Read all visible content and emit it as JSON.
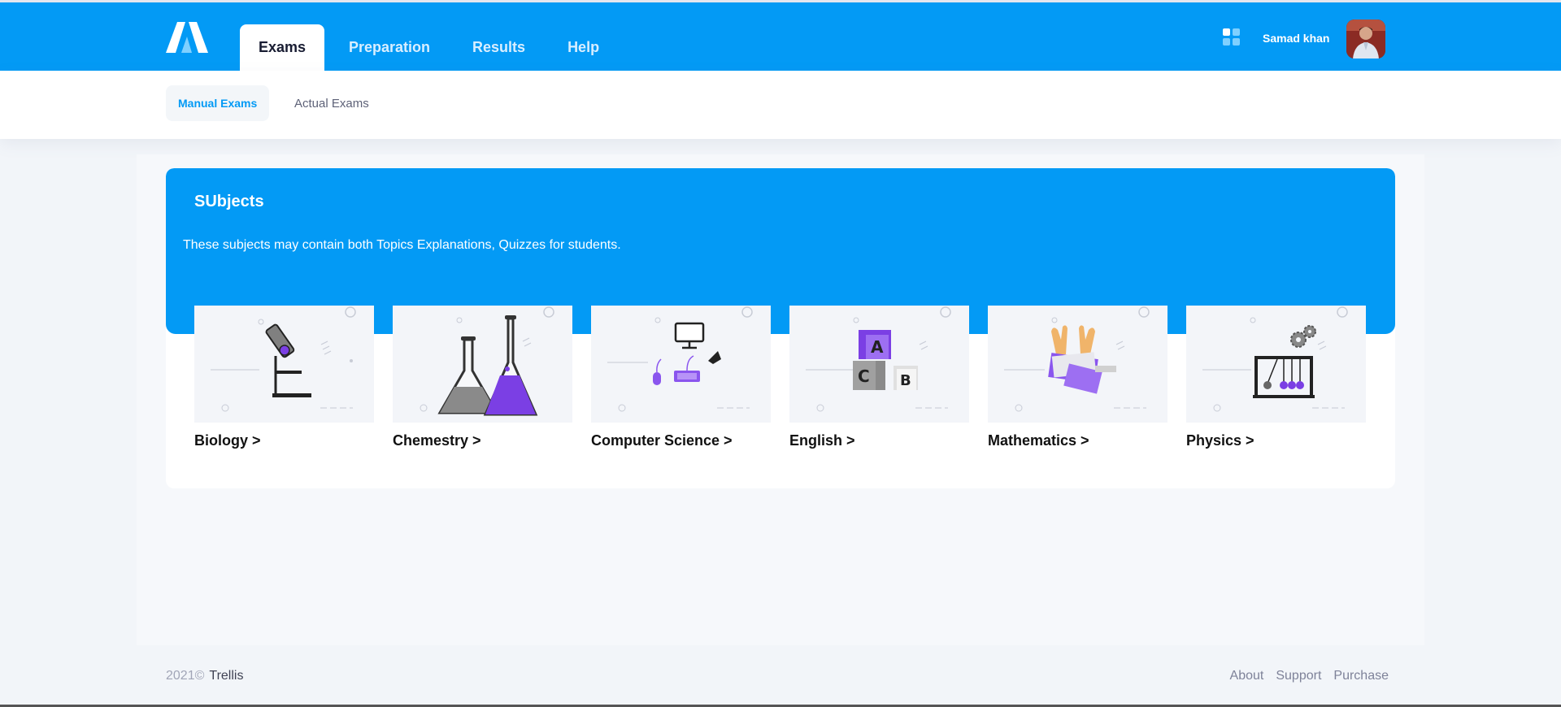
{
  "header": {
    "nav_tabs": [
      {
        "label": "Exams",
        "active": true
      },
      {
        "label": "Preparation",
        "active": false
      },
      {
        "label": "Results",
        "active": false
      },
      {
        "label": "Help",
        "active": false
      }
    ],
    "user_name": "Samad khan",
    "icons": {
      "logo": "brand-logo-icon",
      "apps": "apps-grid-icon",
      "avatar": "user-avatar"
    }
  },
  "subnav": {
    "tabs": [
      {
        "label": "Manual Exams",
        "active": true
      },
      {
        "label": "Actual Exams",
        "active": false
      }
    ]
  },
  "subjects_card": {
    "title": "SUbjects",
    "description": "These subjects may contain both Topics Explanations, Quizzes for students.",
    "items": [
      {
        "label": "Biology >",
        "icon": "microscope-icon"
      },
      {
        "label": "Chemestry >",
        "icon": "flasks-icon"
      },
      {
        "label": "Computer Science >",
        "icon": "computer-icon"
      },
      {
        "label": "English >",
        "icon": "letter-blocks-icon"
      },
      {
        "label": "Mathematics >",
        "icon": "hands-books-icon"
      },
      {
        "label": "Physics >",
        "icon": "newtons-cradle-icon"
      }
    ]
  },
  "footer": {
    "year": "2021©",
    "brand": "Trellis",
    "links": [
      "About",
      "Support",
      "Purchase"
    ]
  },
  "colors": {
    "primary": "#039af5",
    "accent_purple": "#7b3fe4",
    "background": "#f2f5f9"
  }
}
